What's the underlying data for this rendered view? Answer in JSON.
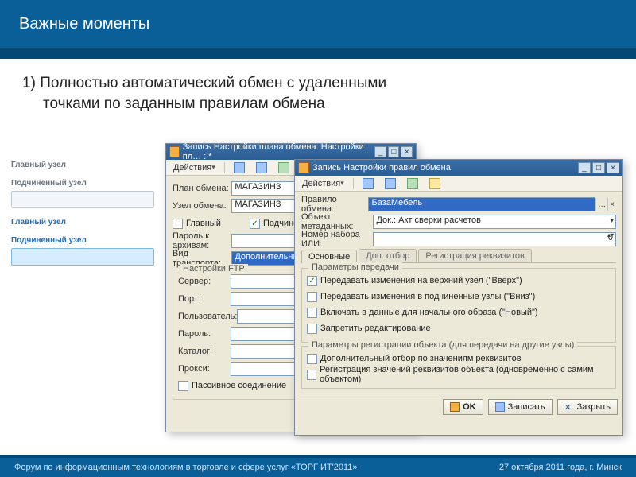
{
  "slide": {
    "title": "Важные моменты",
    "bullet_prefix": "1) ",
    "bullet_line1": "Полностью автоматический обмен с удаленными",
    "bullet_line2": "точками по заданным правилам обмена"
  },
  "diagram": {
    "l1": "Главный\nузел",
    "l2": "Подчиненный\nузел",
    "l3": "Главный\nузел",
    "l4": "Подчиненный\nузел"
  },
  "win1": {
    "title": "Запись Настройки плана обмена: Настройки пл… : *",
    "actions": "Действия",
    "plan_lbl": "План обмена:",
    "plan_val": "МАГАЗИНЗ",
    "node_lbl": "Узел обмена:",
    "node_val": "МАГАЗИНЗ",
    "main_chk": "Главный",
    "sub_chk": "Подчиненный",
    "pwd_lbl": "Пароль к архивам:",
    "trans_lbl": "Вид транспорта:",
    "trans_val": "Дополнительный тр",
    "ftp_legend": "Настройки FTP",
    "srv_lbl": "Сервер:",
    "port_lbl": "Порт:",
    "user_lbl": "Пользователь:",
    "pass_lbl": "Пароль:",
    "dir_lbl": "Каталог:",
    "proxy_lbl": "Прокси:",
    "passive": "Пассивное соединение"
  },
  "win2": {
    "title": "Запись Настройки правил обмена",
    "actions": "Действия",
    "rule_lbl": "Правило обмена:",
    "rule_val": "БазаМебель",
    "meta_lbl": "Объект метаданных:",
    "meta_val": "Док.: Акт сверки расчетов",
    "set_lbl": "Номер набора ИЛИ:",
    "set_val": "0",
    "tab1": "Основные",
    "tab2": "Доп. отбор",
    "tab3": "Регистрация реквизитов",
    "grp1": "Параметры передачи",
    "c1": "Передавать изменения на верхний узел (\"Вверх\")",
    "c2": "Передавать изменения в подчиненные узлы (\"Вниз\")",
    "c3": "Включать в данные для начального образа (\"Новый\")",
    "c4": "Запретить редактирование",
    "grp2": "Параметры регистрации объекта (для передачи на другие узлы)",
    "c5": "Дополнительный отбор по значениям реквизитов",
    "c6": "Регистрация значений реквизитов объекта (одновременно с самим объектом)",
    "btn_ok": "OK",
    "btn_save": "Записать",
    "btn_close": "Закрыть"
  },
  "footer": {
    "left": "Форум по информационным технологиям в торговле и сфере услуг  «ТОРГ ИТ'2011»",
    "right": "27 октября 2011 года, г. Минск"
  }
}
